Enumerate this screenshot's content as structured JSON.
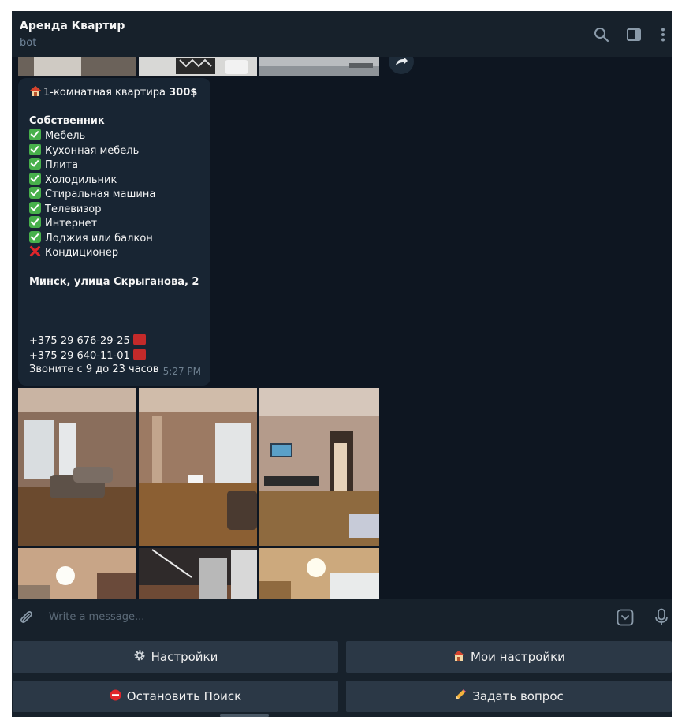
{
  "header": {
    "title": "Аренда Квартир",
    "subtitle": "bot",
    "icons": [
      "search-icon",
      "sidebar-panel-icon",
      "more-vertical-icon"
    ]
  },
  "message": {
    "title_prefix": "1-комнатная квартира ",
    "price": "300$",
    "owner_label": "Собственник",
    "amenities": [
      {
        "label": "Мебель",
        "available": true
      },
      {
        "label": "Кухонная мебель",
        "available": true
      },
      {
        "label": "Плита",
        "available": true
      },
      {
        "label": "Холодильник",
        "available": true
      },
      {
        "label": "Стиральная машина",
        "available": true
      },
      {
        "label": "Телевизор",
        "available": true
      },
      {
        "label": "Интернет",
        "available": true
      },
      {
        "label": "Лоджия или балкон",
        "available": true
      },
      {
        "label": "Кондиционер",
        "available": false
      }
    ],
    "address": "Минск, улица Скрыганова, 2",
    "phones": [
      "+375 29 676-29-25",
      "+375 29 640-11-01"
    ],
    "call_hours": "Звоните с 9 до 23 часов",
    "time": "5:27 PM"
  },
  "input": {
    "placeholder": "Write a message..."
  },
  "keyboard": {
    "settings": "Настройки",
    "my_settings": "Мои настройки",
    "stop_search": "Остановить Поиск",
    "ask_question": "Задать вопрос"
  },
  "colors": {
    "chat_bg": "#0e1621",
    "bubble_bg": "#182533",
    "panel_bg": "#17212b",
    "button_bg": "#2b3846",
    "check_green": "#47b04b",
    "cross_red": "#e0252b"
  }
}
